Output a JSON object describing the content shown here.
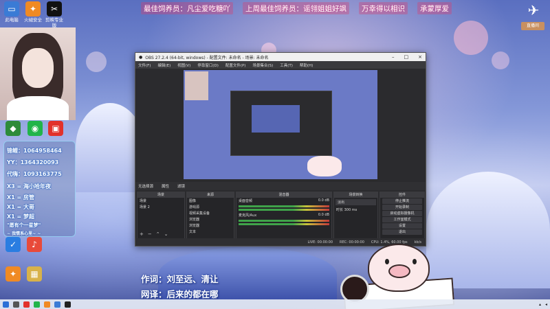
{
  "banner": {
    "msg1": "最佳饲养员：凡尘爱吃糖吖",
    "msg2": "上周最佳饲养员：谣翎姐姐好飒",
    "msg3": "万幸得以相识",
    "msg4": "承蒙厚爱"
  },
  "desktop_icons": [
    {
      "label": "此电脑",
      "icon": "computer-icon",
      "color": "#3a7bd5",
      "glyph": "▭"
    },
    {
      "label": "火绒安全",
      "icon": "flame-icon",
      "color": "#f08a24",
      "glyph": "✦"
    },
    {
      "label": "剪映专业版",
      "icon": "capcut-icon",
      "color": "#111111",
      "glyph": "✂"
    },
    {
      "label": "微信",
      "icon": "wechat-icon",
      "color": "#21b44a",
      "glyph": "◉"
    },
    {
      "label": "新浪",
      "icon": "app-icon",
      "color": "#e2312b",
      "glyph": "▣"
    },
    {
      "label": "腾讯",
      "icon": "app-icon",
      "color": "#2e8b3a",
      "glyph": "◆"
    },
    {
      "label": "火绒安全",
      "icon": "shield-icon",
      "color": "#2a7de1",
      "glyph": "✓"
    },
    {
      "label": "网易云",
      "icon": "music-icon",
      "color": "#e84a3a",
      "glyph": "♪"
    },
    {
      "label": "火绒安全",
      "icon": "flame-icon",
      "color": "#f08a24",
      "glyph": "✦"
    },
    {
      "label": "直播",
      "icon": "pixel-icon",
      "color": "#d8b24a",
      "glyph": "▦"
    }
  ],
  "chat": [
    "锦鲤：1064958464",
    "YY：1364320093",
    "代嗨：1093163775",
    "X3 = 海小哈年夜",
    "X1 = 房管",
    "X1 = 大哥",
    "X1 = 梦超",
    "\"愿有个一星梦\"",
    "~ 我情系心里~ ~"
  ],
  "obs": {
    "title": "OBS 27.2.4 (64-bit, windows) - 配置文件: 未命名 - 场景: 未命名",
    "menus": [
      "文件(F)",
      "编辑(E)",
      "视图(V)",
      "停靠窗口(D)",
      "配置文件(P)",
      "场景集合(S)",
      "工具(T)",
      "帮助(H)"
    ],
    "toolbar": [
      "无选择源",
      "属性",
      "滤镜"
    ],
    "scenes_header": "场景",
    "scenes": [
      "场景",
      "场景 2"
    ],
    "sources_header": "来源",
    "sources": [
      "图像",
      "游戏源",
      "视频采集设备",
      "浏览器",
      "浏览器",
      "文本"
    ],
    "mixer_header": "混音器",
    "mixer": [
      {
        "label": "桌面音频",
        "db": "0.0 dB"
      },
      {
        "label": "麦克风/Aux",
        "db": "0.0 dB"
      }
    ],
    "transitions_header": "场景转换",
    "transition_type": "淡出",
    "duration_label": "时长",
    "duration_value": "300 ms",
    "controls_header": "控件",
    "controls": [
      "停止推流",
      "开始录制",
      "启动虚拟摄像机",
      "工作室模式",
      "设置",
      "退出"
    ],
    "status": [
      "LIVE: 00:00:00",
      "REC: 00:00:00",
      "CPU: 1.4%, 60.00 fps",
      "kb/s"
    ]
  },
  "lyrics": {
    "line1": "作词：刘至远、清让",
    "line2": "网译：后来的都在哪"
  },
  "overlay_right": {
    "badge": "直播间"
  }
}
